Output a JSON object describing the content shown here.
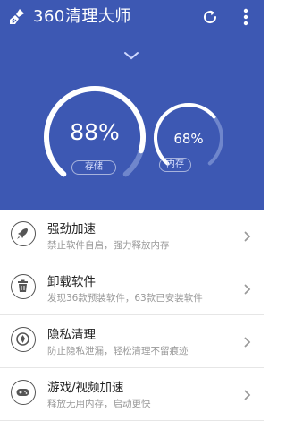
{
  "header": {
    "title": "360清理大师",
    "logo_icon": "broom-icon",
    "refresh_icon": "refresh-icon",
    "more_icon": "more-vertical-icon"
  },
  "gauges": {
    "storage": {
      "value": "88%",
      "label": "存储",
      "percent": 88
    },
    "memory": {
      "value": "68%",
      "label": "内存",
      "percent": 68
    }
  },
  "colors": {
    "header_bg": "#3d58b3",
    "track": "#6f86cc",
    "fill": "#ffffff"
  },
  "menu": [
    {
      "title": "强劲加速",
      "subtitle": "禁止软件自启，强力释放内存",
      "icon": "rocket-icon"
    },
    {
      "title": "卸载软件",
      "subtitle": "发现36款预装软件，63款已安装软件",
      "icon": "trash-icon"
    },
    {
      "title": "隐私清理",
      "subtitle": "防止隐私泄漏，轻松清理不留痕迹",
      "icon": "privacy-icon"
    },
    {
      "title": "游戏/视频加速",
      "subtitle": "释放无用内存，启动更快",
      "icon": "gamepad-icon"
    }
  ]
}
